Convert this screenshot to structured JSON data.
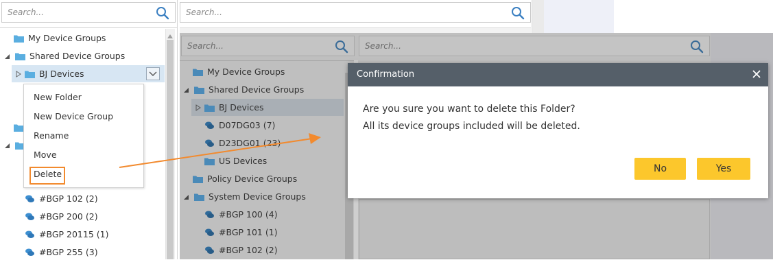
{
  "left_panel": {
    "search_placeholder": "Search...",
    "tree": [
      {
        "label": "My Device Groups"
      },
      {
        "label": "Shared Device Groups"
      },
      {
        "label": "BJ Devices"
      },
      {
        "label": "#BGP 102 (2)"
      },
      {
        "label": "#BGP 200 (2)"
      },
      {
        "label": "#BGP 20115 (1)"
      },
      {
        "label": "#BGP 255 (3)"
      }
    ]
  },
  "context_menu": {
    "items": [
      "New Folder",
      "New Device Group",
      "Rename",
      "Move",
      "Delete"
    ]
  },
  "mid_top": {
    "search_placeholder": "Search..."
  },
  "background_panel": {
    "search_left_placeholder": "Search...",
    "search_right_placeholder": "Search...",
    "tree": [
      {
        "label": "My Device Groups"
      },
      {
        "label": "Shared Device Groups"
      },
      {
        "label": "BJ Devices"
      },
      {
        "label": "D07DG03 (7)"
      },
      {
        "label": "D23DG01 (23)"
      },
      {
        "label": "US Devices"
      },
      {
        "label": "Policy Device Groups"
      },
      {
        "label": "System Device Groups"
      },
      {
        "label": "#BGP 100 (4)"
      },
      {
        "label": "#BGP 101 (1)"
      },
      {
        "label": "#BGP 102 (2)"
      }
    ]
  },
  "modal": {
    "title": "Confirmation",
    "line1": "Are you sure you want to delete this Folder?",
    "line2": "All its device groups included will be deleted.",
    "no_label": "No",
    "yes_label": "Yes"
  },
  "colors": {
    "highlight_orange": "#f28a2e",
    "button_yellow": "#fcc72c",
    "modal_header": "#555f69",
    "overlay_gray": "#bfbfbf",
    "folder_blue": "#5aaee0"
  }
}
